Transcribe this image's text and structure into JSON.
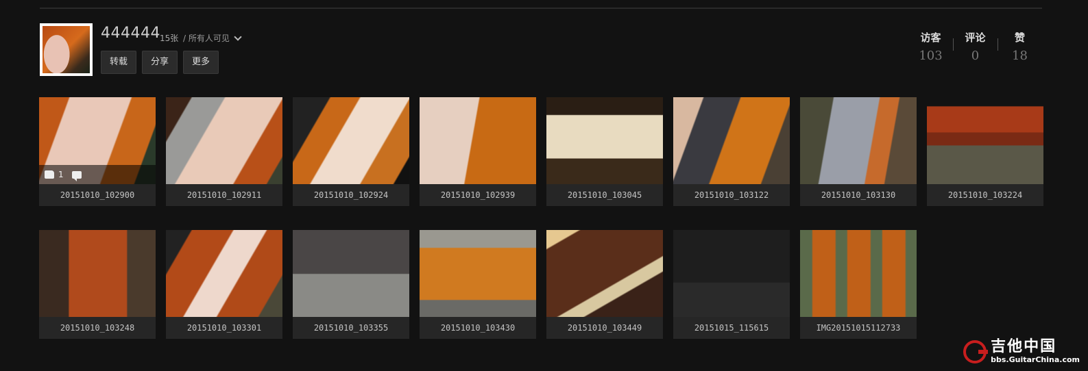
{
  "album": {
    "title": "444444",
    "count": "15张",
    "privacy": "/ 所有人可见",
    "actions": [
      "转载",
      "分享",
      "更多"
    ]
  },
  "stats": [
    {
      "label": "访客",
      "value": "103"
    },
    {
      "label": "评论",
      "value": "0"
    },
    {
      "label": "赞",
      "value": "18"
    }
  ],
  "photos": [
    {
      "caption": "20151010_102900",
      "likes": "1"
    },
    {
      "caption": "20151010_102911"
    },
    {
      "caption": "20151010_102924"
    },
    {
      "caption": "20151010_102939"
    },
    {
      "caption": "20151010_103045"
    },
    {
      "caption": "20151010_103122"
    },
    {
      "caption": "20151010_103130"
    },
    {
      "caption": "20151010_103224"
    },
    {
      "caption": "20151010_103248"
    },
    {
      "caption": "20151010_103301"
    },
    {
      "caption": "20151010_103355"
    },
    {
      "caption": "20151010_103430"
    },
    {
      "caption": "20151010_103449"
    },
    {
      "caption": "20151015_115615"
    },
    {
      "caption": "IMG20151015112733"
    }
  ],
  "watermark": {
    "name": "吉他中国",
    "url": "bbs.GuitarChina.com"
  },
  "colors": {
    "background": "#121212",
    "tile": "#262626",
    "button": "#2b2b2b",
    "watermark_red": "#c81e1e"
  }
}
